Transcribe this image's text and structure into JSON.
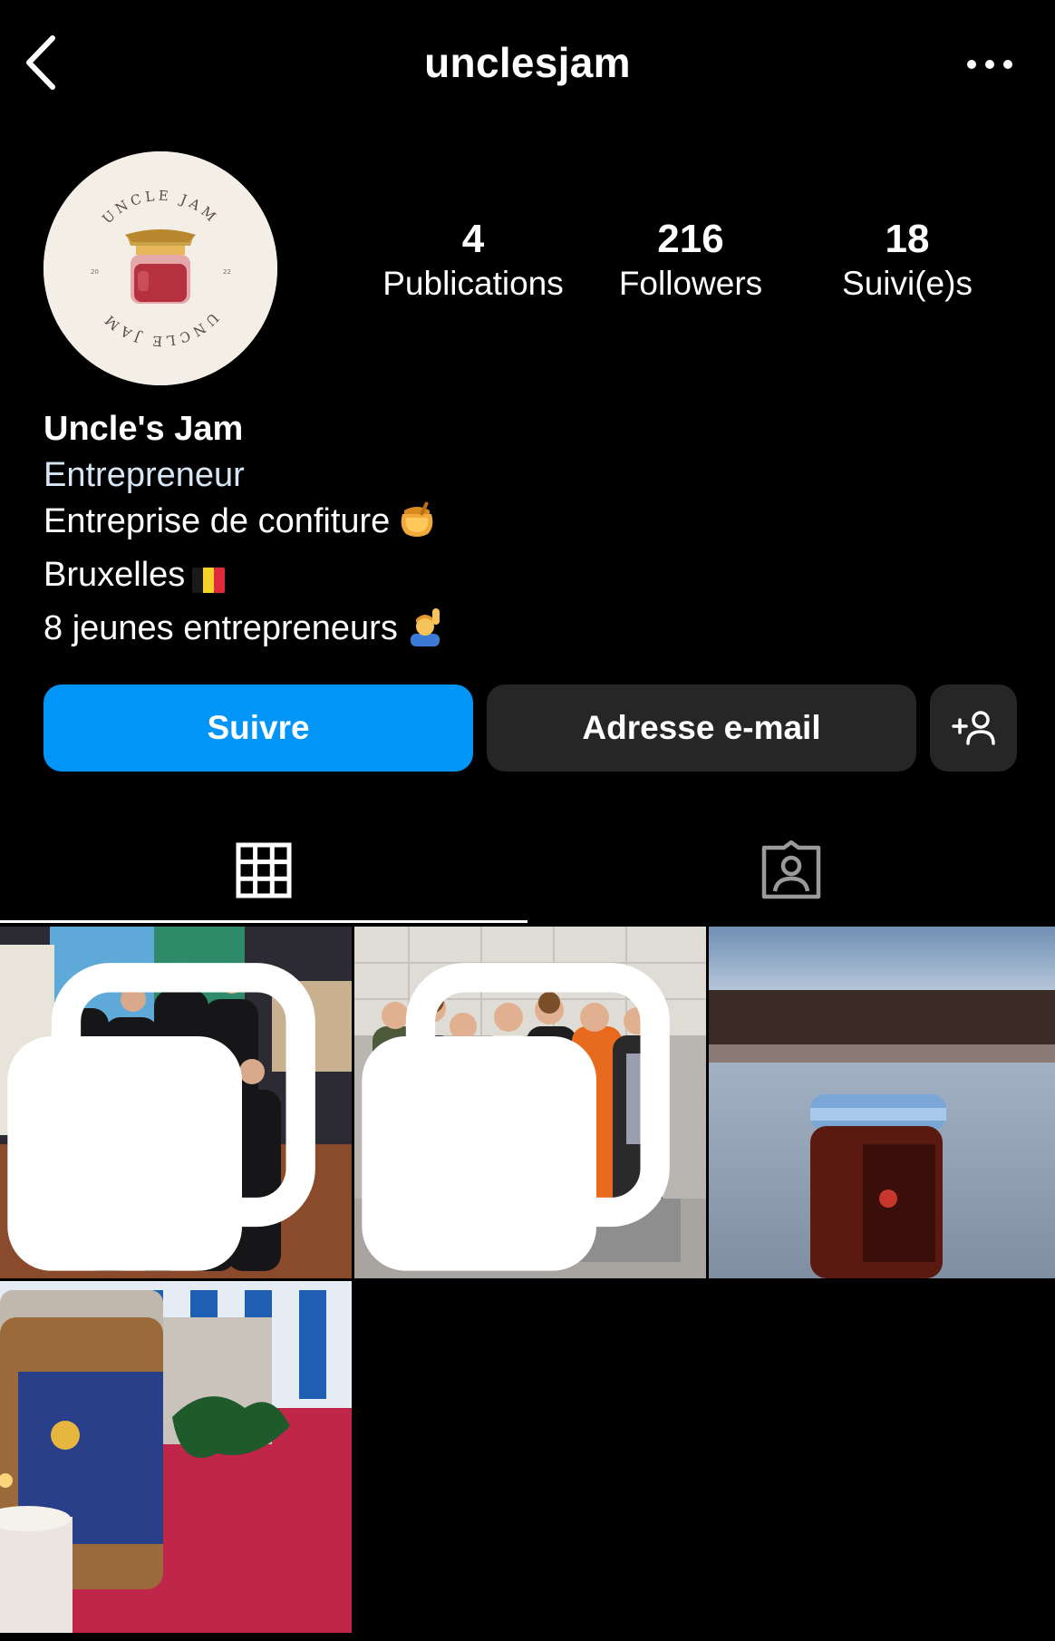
{
  "header": {
    "username": "unclesjam",
    "back_icon": "chevron-left-icon",
    "more_icon": "more-horizontal-icon"
  },
  "profile": {
    "avatar_text_top": "UNCLE JAM",
    "avatar_text_bottom": "UNCLE JAM",
    "avatar_year_left": "20",
    "avatar_year_right": "22",
    "stats": [
      {
        "value": "4",
        "label": "Publications"
      },
      {
        "value": "216",
        "label": "Followers"
      },
      {
        "value": "18",
        "label": "Suivi(e)s"
      }
    ],
    "display_name": "Uncle's Jam",
    "category": "Entrepreneur",
    "bio_lines": [
      {
        "text": "Entreprise de confiture",
        "emoji": "honey-pot-emoji"
      },
      {
        "text": "Bruxelles",
        "emoji": "belgium-flag-emoji"
      },
      {
        "text": "8 jeunes entrepreneurs",
        "emoji": "man-raising-hand-emoji"
      }
    ]
  },
  "actions": {
    "follow_label": "Suivre",
    "email_label": "Adresse e-mail",
    "add_user_icon": "add-user-icon"
  },
  "tabs": [
    {
      "name": "posts-grid",
      "icon": "grid-icon",
      "active": true
    },
    {
      "name": "tagged",
      "icon": "tagged-user-icon",
      "active": false
    }
  ],
  "posts": [
    {
      "kind": "photo",
      "description_icon": "group-photo",
      "multiple": true
    },
    {
      "kind": "photo",
      "description_icon": "group-photo",
      "multiple": true
    },
    {
      "kind": "photo",
      "description_icon": "jam-jar-photo",
      "multiple": false
    },
    {
      "kind": "photo",
      "description_icon": "jam-jar-photo",
      "multiple": false
    }
  ],
  "colors": {
    "background": "#000000",
    "follow_button": "#0095f6",
    "secondary_button": "#262626",
    "category_text": "#d6e6f5"
  }
}
